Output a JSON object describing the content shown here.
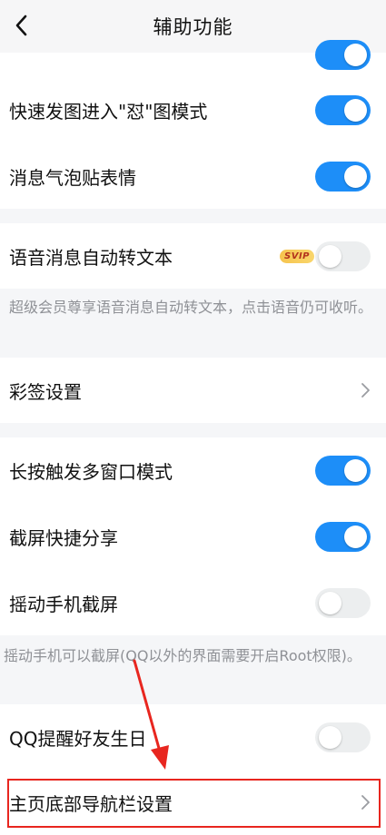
{
  "header": {
    "title": "辅助功能",
    "back_icon": "chevron-left-icon"
  },
  "settings": [
    {
      "label": "快速发图进入\"怼\"图模式",
      "toggle": "on"
    },
    {
      "label": "消息气泡贴表情",
      "toggle": "on"
    },
    {
      "label": "语音消息自动转文本",
      "toggle": "off",
      "badge": "SVIP"
    },
    {
      "label": "彩签设置",
      "chevron": true
    },
    {
      "label": "长按触发多窗口模式",
      "toggle": "on"
    },
    {
      "label": "截屏快捷分享",
      "toggle": "on"
    },
    {
      "label": "摇动手机截屏",
      "toggle": "off"
    },
    {
      "label": "QQ提醒好友生日",
      "toggle": "off"
    },
    {
      "label": "主页底部导航栏设置",
      "chevron": true
    }
  ],
  "notes": {
    "voice_note": "超级会员尊享语音消息自动转文本，点击语音仍可收听。",
    "shake_note": "摇动手机可以截屏(QQ以外的界面需要开启Root权限)。"
  },
  "colors": {
    "toggle_on": "#1d8ef8",
    "toggle_off": "#eceeef",
    "annotation": "#e8261f"
  }
}
